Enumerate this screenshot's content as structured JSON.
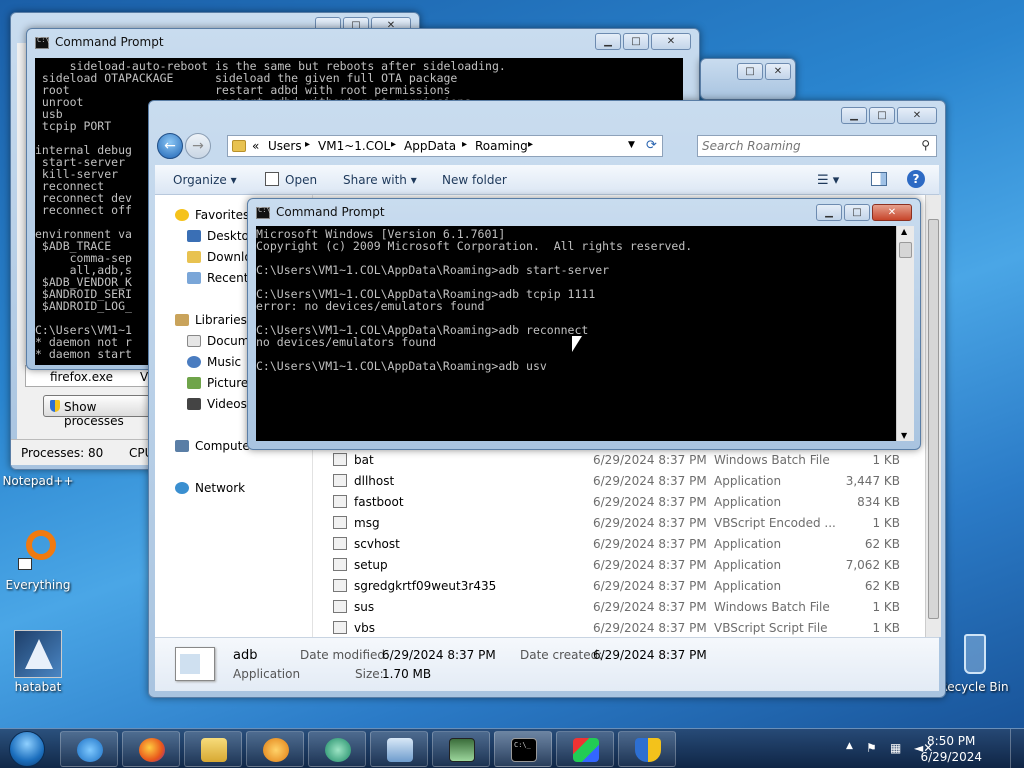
{
  "desktop": {
    "icons": [
      {
        "label": "Notepad++"
      },
      {
        "label": "Everything"
      },
      {
        "label": "hatabat"
      },
      {
        "label": "Recycle Bin"
      }
    ]
  },
  "task_manager": {
    "rows": [
      "firefox.exe",
      "VM"
    ],
    "show_processes_label": "Show processes",
    "status_processes": "Processes: 80",
    "status_cpu": "CPU"
  },
  "cmd_back": {
    "title": "Command Prompt",
    "lines": [
      "     sideload-auto-reboot is the same but reboots after sideloading.",
      " sideload OTAPACKAGE      sideload the given full OTA package",
      " root                     restart adbd with root permissions",
      " unroot                   restart adbd without root permissions",
      " usb",
      " tcpip PORT",
      "",
      "internal debug",
      " start-server",
      " kill-server",
      " reconnect",
      " reconnect dev",
      " reconnect off",
      "",
      "environment va",
      " $ADB_TRACE",
      "     comma-sep",
      "     all,adb,s",
      " $ADB_VENDOR_K",
      " $ANDROID_SERI",
      " $ANDROID_LOG_",
      "",
      "C:\\Users\\VM1~1",
      "* daemon not r",
      "* daemon start"
    ]
  },
  "explorer": {
    "breadcrumb": [
      "«",
      "Users",
      "VM1~1.COL",
      "AppData",
      "Roaming"
    ],
    "search_placeholder": "Search Roaming",
    "toolbar": {
      "organize": "Organize ▾",
      "open": "Open",
      "share_with": "Share with ▾",
      "new_folder": "New folder"
    },
    "nav": {
      "favorites": "Favorites",
      "desktop": "Desktop",
      "downloads": "Downlo",
      "recent": "Recent",
      "libraries": "Libraries",
      "documents": "Docum",
      "music": "Music",
      "pictures": "Pictures",
      "videos": "Videos",
      "computer": "Compute",
      "network": "Network"
    },
    "files": [
      {
        "name": "bat",
        "date": "6/29/2024 8:37 PM",
        "type": "Windows Batch File",
        "size": "1 KB"
      },
      {
        "name": "dllhost",
        "date": "6/29/2024 8:37 PM",
        "type": "Application",
        "size": "3,447 KB"
      },
      {
        "name": "fastboot",
        "date": "6/29/2024 8:37 PM",
        "type": "Application",
        "size": "834 KB"
      },
      {
        "name": "msg",
        "date": "6/29/2024 8:37 PM",
        "type": "VBScript Encoded ...",
        "size": "1 KB"
      },
      {
        "name": "scvhost",
        "date": "6/29/2024 8:37 PM",
        "type": "Application",
        "size": "62 KB"
      },
      {
        "name": "setup",
        "date": "6/29/2024 8:37 PM",
        "type": "Application",
        "size": "7,062 KB"
      },
      {
        "name": "sgredgkrtf09weut3r435",
        "date": "6/29/2024 8:37 PM",
        "type": "Application",
        "size": "62 KB"
      },
      {
        "name": "sus",
        "date": "6/29/2024 8:37 PM",
        "type": "Windows Batch File",
        "size": "1 KB"
      },
      {
        "name": "vbs",
        "date": "6/29/2024 8:37 PM",
        "type": "VBScript Script File",
        "size": "1 KB"
      }
    ],
    "details": {
      "name": "adb",
      "type": "Application",
      "modified_label": "Date modified:",
      "modified_value": "6/29/2024 8:37 PM",
      "created_label": "Date created:",
      "created_value": "6/29/2024 8:37 PM",
      "size_label": "Size:",
      "size_value": "1.70 MB"
    }
  },
  "cmd_front": {
    "title": "Command Prompt",
    "lines": [
      "Microsoft Windows [Version 6.1.7601]",
      "Copyright (c) 2009 Microsoft Corporation.  All rights reserved.",
      "",
      "C:\\Users\\VM1~1.COL\\AppData\\Roaming>adb start-server",
      "",
      "C:\\Users\\VM1~1.COL\\AppData\\Roaming>adb tcpip 1111",
      "error: no devices/emulators found",
      "",
      "C:\\Users\\VM1~1.COL\\AppData\\Roaming>adb reconnect",
      "no devices/emulators found",
      "",
      "C:\\Users\\VM1~1.COL\\AppData\\Roaming>adb usv"
    ]
  },
  "taskbar": {
    "time": "8:50 PM",
    "date": "6/29/2024",
    "cmd_glyph": "C:\\_"
  },
  "colors": {
    "accent": "#2a85cf",
    "console_bg": "#000000",
    "console_fg": "#c0c0c0"
  }
}
